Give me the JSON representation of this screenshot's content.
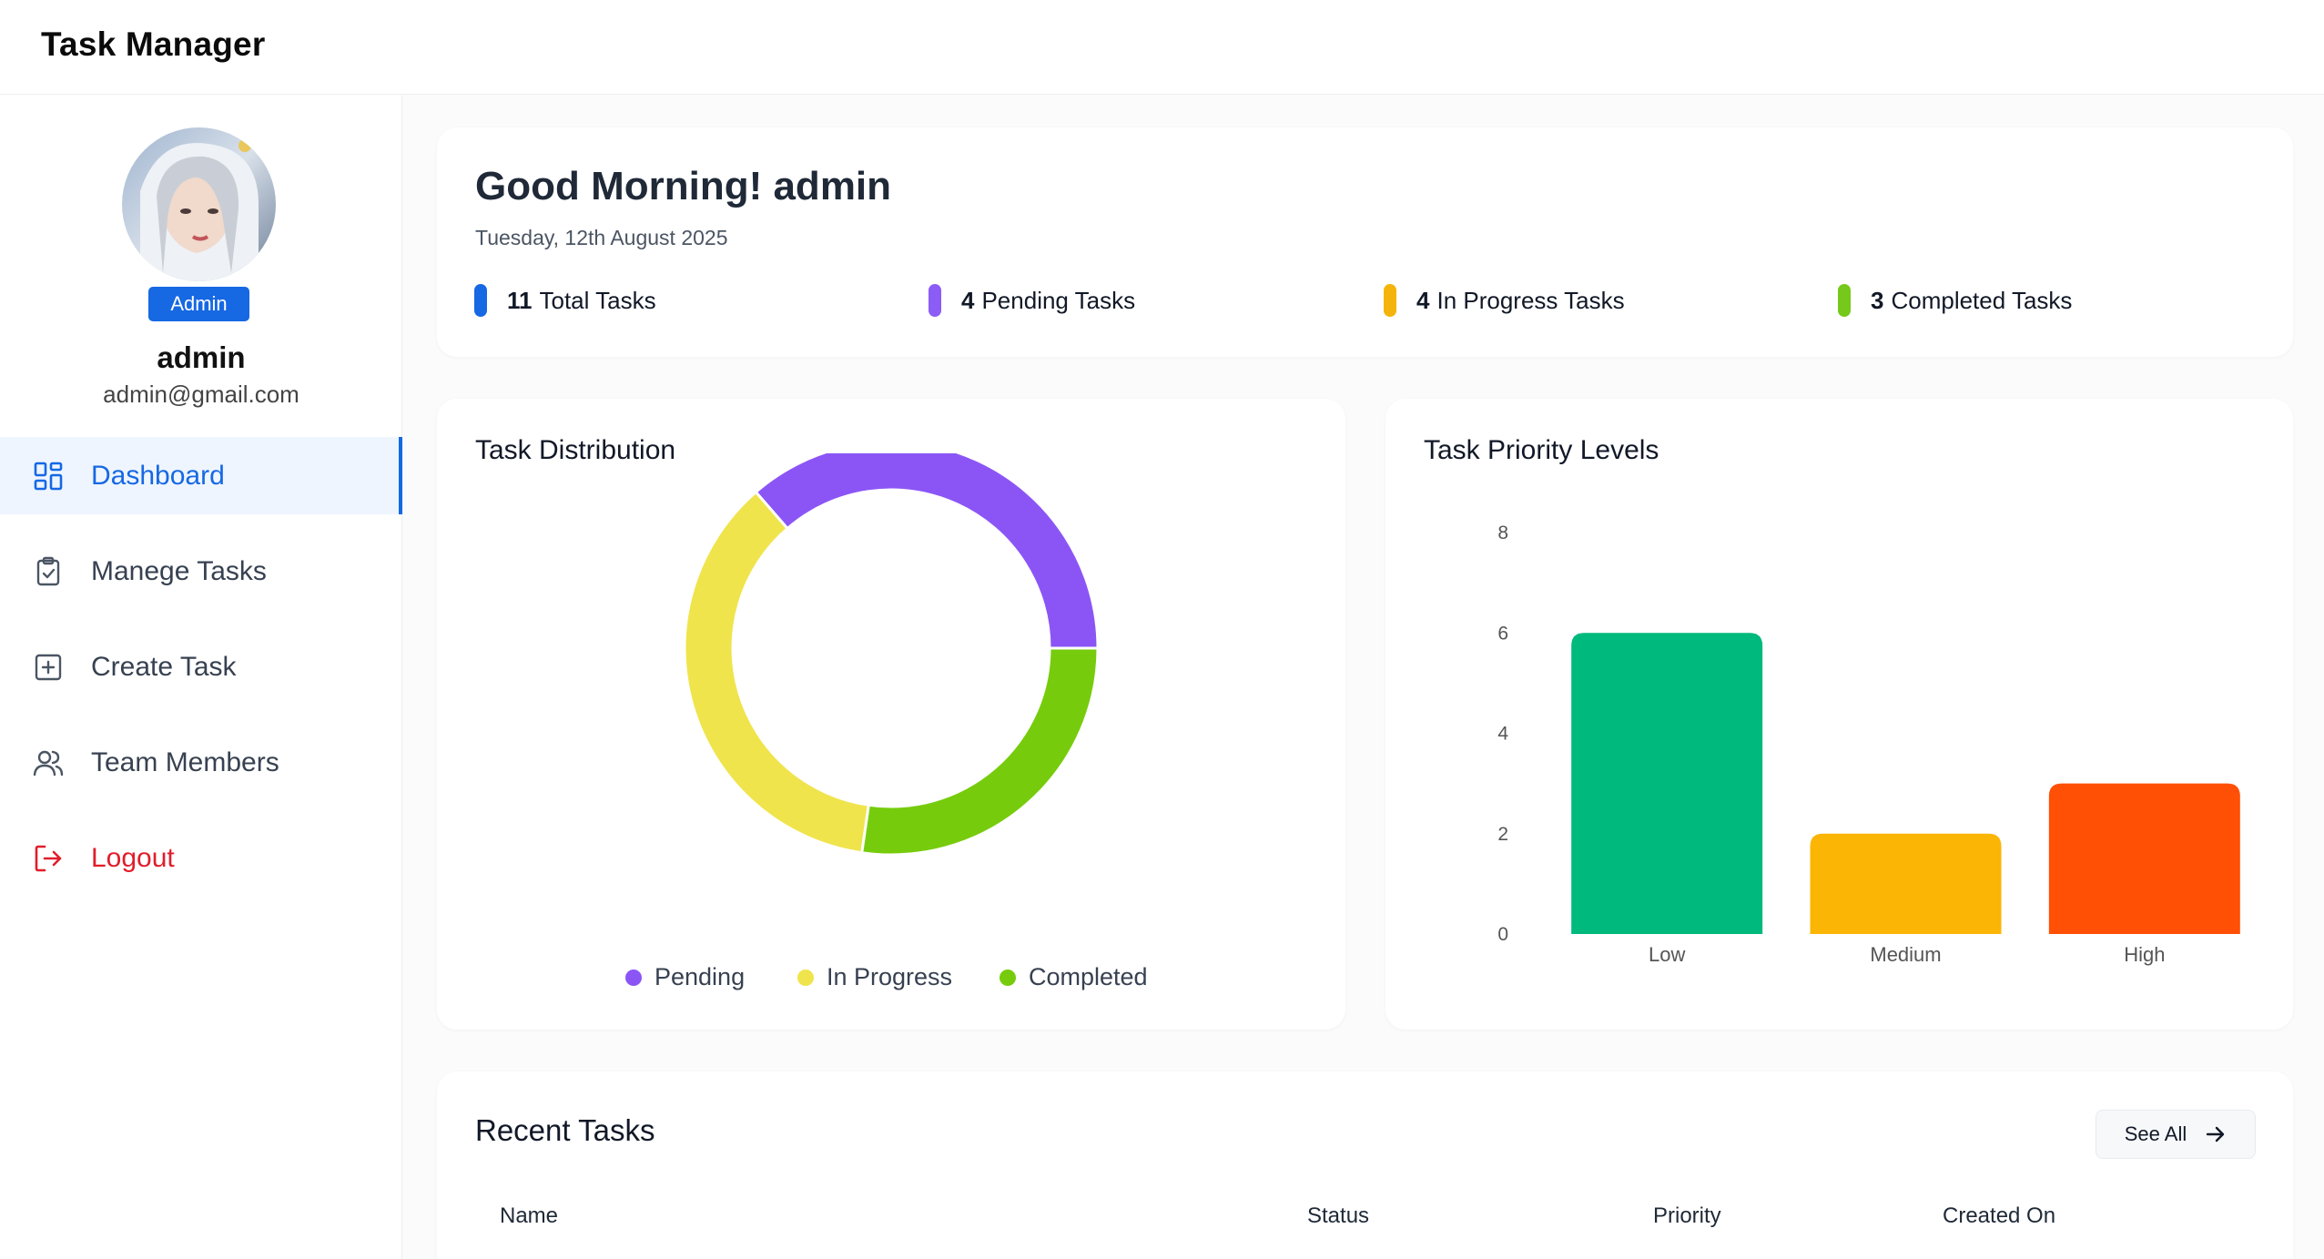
{
  "app": {
    "title": "Task Manager"
  },
  "user": {
    "role": "Admin",
    "name": "admin",
    "email": "admin@gmail.com"
  },
  "sidebar": {
    "items": [
      {
        "label": "Dashboard",
        "icon": "dashboard-grid-icon",
        "active": true
      },
      {
        "label": "Manege Tasks",
        "icon": "clipboard-check-icon"
      },
      {
        "label": "Create Task",
        "icon": "plus-square-icon"
      },
      {
        "label": "Team Members",
        "icon": "users-icon"
      },
      {
        "label": "Logout",
        "icon": "logout-icon"
      }
    ]
  },
  "greeting": {
    "title": "Good Morning! admin",
    "date": "Tuesday, 12th August 2025"
  },
  "stats": [
    {
      "count": "11",
      "label": "Total Tasks",
      "color": "#1668e3"
    },
    {
      "count": "4",
      "label": "Pending Tasks",
      "color": "#8b5cf6"
    },
    {
      "count": "4",
      "label": "In Progress Tasks",
      "color": "#f5b40b"
    },
    {
      "count": "3",
      "label": "Completed Tasks",
      "color": "#76c81a"
    }
  ],
  "distribution": {
    "title": "Task Distribution",
    "legend": [
      {
        "label": "Pending",
        "color": "#8b55f6"
      },
      {
        "label": "In Progress",
        "color": "#f0e44c"
      },
      {
        "label": "Completed",
        "color": "#76cc0c"
      }
    ]
  },
  "priority": {
    "title": "Task Priority Levels"
  },
  "recent": {
    "title": "Recent Tasks",
    "see_all": "See All",
    "columns": [
      "Name",
      "Status",
      "Priority",
      "Created On"
    ]
  },
  "chart_data": [
    {
      "type": "pie",
      "variant": "donut",
      "categories": [
        "Pending",
        "In Progress",
        "Completed"
      ],
      "values": [
        4,
        4,
        3
      ],
      "colors": [
        "#8b55f6",
        "#f0e44c",
        "#76cc0c"
      ]
    },
    {
      "type": "bar",
      "categories": [
        "Low",
        "Medium",
        "High"
      ],
      "values": [
        6,
        2,
        3
      ],
      "colors": [
        "#00b97c",
        "#fbb505",
        "#ff5005"
      ],
      "ylim": [
        0,
        8
      ],
      "yticks": [
        0,
        2,
        4,
        6,
        8
      ]
    }
  ]
}
